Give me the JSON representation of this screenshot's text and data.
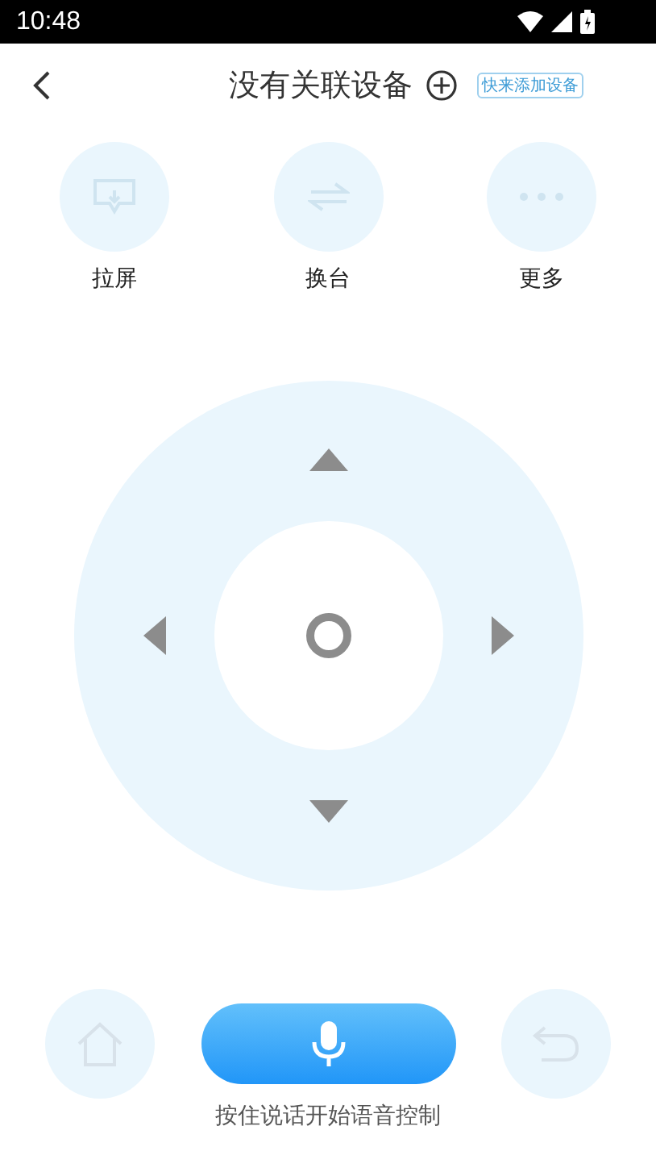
{
  "status_bar": {
    "time": "10:48"
  },
  "header": {
    "title": "没有关联设备",
    "add_hint": "快来添加设备"
  },
  "quick_actions": [
    {
      "kind": "cast",
      "label": "拉屏"
    },
    {
      "kind": "switch",
      "label": "换台"
    },
    {
      "kind": "more",
      "label": "更多"
    }
  ],
  "voice": {
    "hint": "按住说话开始语音控制"
  }
}
